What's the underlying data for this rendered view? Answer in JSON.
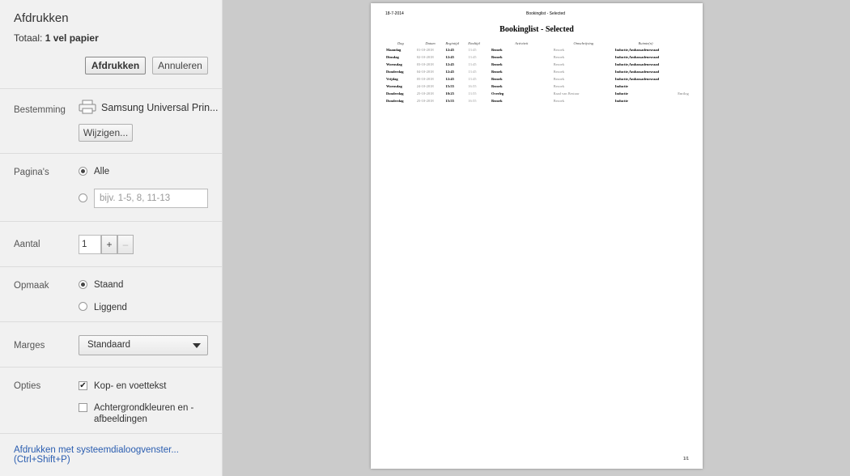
{
  "header": {
    "title": "Afdrukken",
    "total_prefix": "Totaal:",
    "total_value": "1 vel papier"
  },
  "buttons": {
    "print": "Afdrukken",
    "cancel": "Annuleren",
    "change": "Wijzigen..."
  },
  "destination": {
    "label": "Bestemming",
    "printer": "Samsung Universal Prin..."
  },
  "pages": {
    "label": "Pagina's",
    "all": "Alle",
    "placeholder": "bijv. 1-5, 8, 11-13",
    "selected": "Alle"
  },
  "copies": {
    "label": "Aantal",
    "value": "1",
    "plus": "+",
    "minus": "–"
  },
  "layout": {
    "label": "Opmaak",
    "portrait": "Staand",
    "landscape": "Liggend",
    "selected": "Staand"
  },
  "margins": {
    "label": "Marges",
    "value": "Standaard"
  },
  "options": {
    "label": "Opties",
    "headers_footers": "Kop- en voettekst",
    "headers_checked": true,
    "background": "Achtergrondkleuren en -",
    "background2": "afbeeldingen",
    "background_checked": false
  },
  "system_dialog_link": "Afdrukken met systeemdialoogvenster... (Ctrl+Shift+P)",
  "preview": {
    "date": "18-7-2014",
    "header_title": "Bookinglist - Selected",
    "title": "Bookinglist - Selected",
    "page_number": "1/1",
    "columns": [
      "Dag",
      "Datum",
      "Begintijd",
      "Eindtijd",
      "Activiteit",
      "Omschrijving",
      "Ruimte(n)"
    ],
    "rows": [
      [
        "Maandag",
        "01-10-2018",
        "12:45",
        "13:45",
        "Bezoek",
        "Bezoek",
        "Inductie,Ambassadeursraad",
        ""
      ],
      [
        "Dinsdag",
        "02-10-2018",
        "12:45",
        "13:45",
        "Bezoek",
        "Bezoek",
        "Inductie,Ambassadeursraad",
        ""
      ],
      [
        "Woensdag",
        "03-10-2018",
        "12:45",
        "13:45",
        "Bezoek",
        "Bezoek",
        "Inductie,Ambassadeursraad",
        ""
      ],
      [
        "Donderdag",
        "04-10-2018",
        "12:45",
        "13:45",
        "Bezoek",
        "Bezoek",
        "Inductie,Ambassadeursraad",
        ""
      ],
      [
        "Vrijdag",
        "05-10-2018",
        "12:45",
        "13:45",
        "Bezoek",
        "Bezoek",
        "Inductie,Ambassadeursraad",
        ""
      ],
      [
        "Woensdag",
        "24-10-2018",
        "15:55",
        "16:55",
        "Bezoek",
        "Bezoek",
        "Inductie",
        ""
      ],
      [
        "Donderdag",
        "25-10-2018",
        "10:25",
        "13:55",
        "Overleg",
        "Raad van Bestuur",
        "Inductie",
        "Enrilog"
      ],
      [
        "Donderdag",
        "25-10-2018",
        "15:55",
        "16:55",
        "Bezoek",
        "Bezoek",
        "Inductie",
        ""
      ]
    ]
  }
}
